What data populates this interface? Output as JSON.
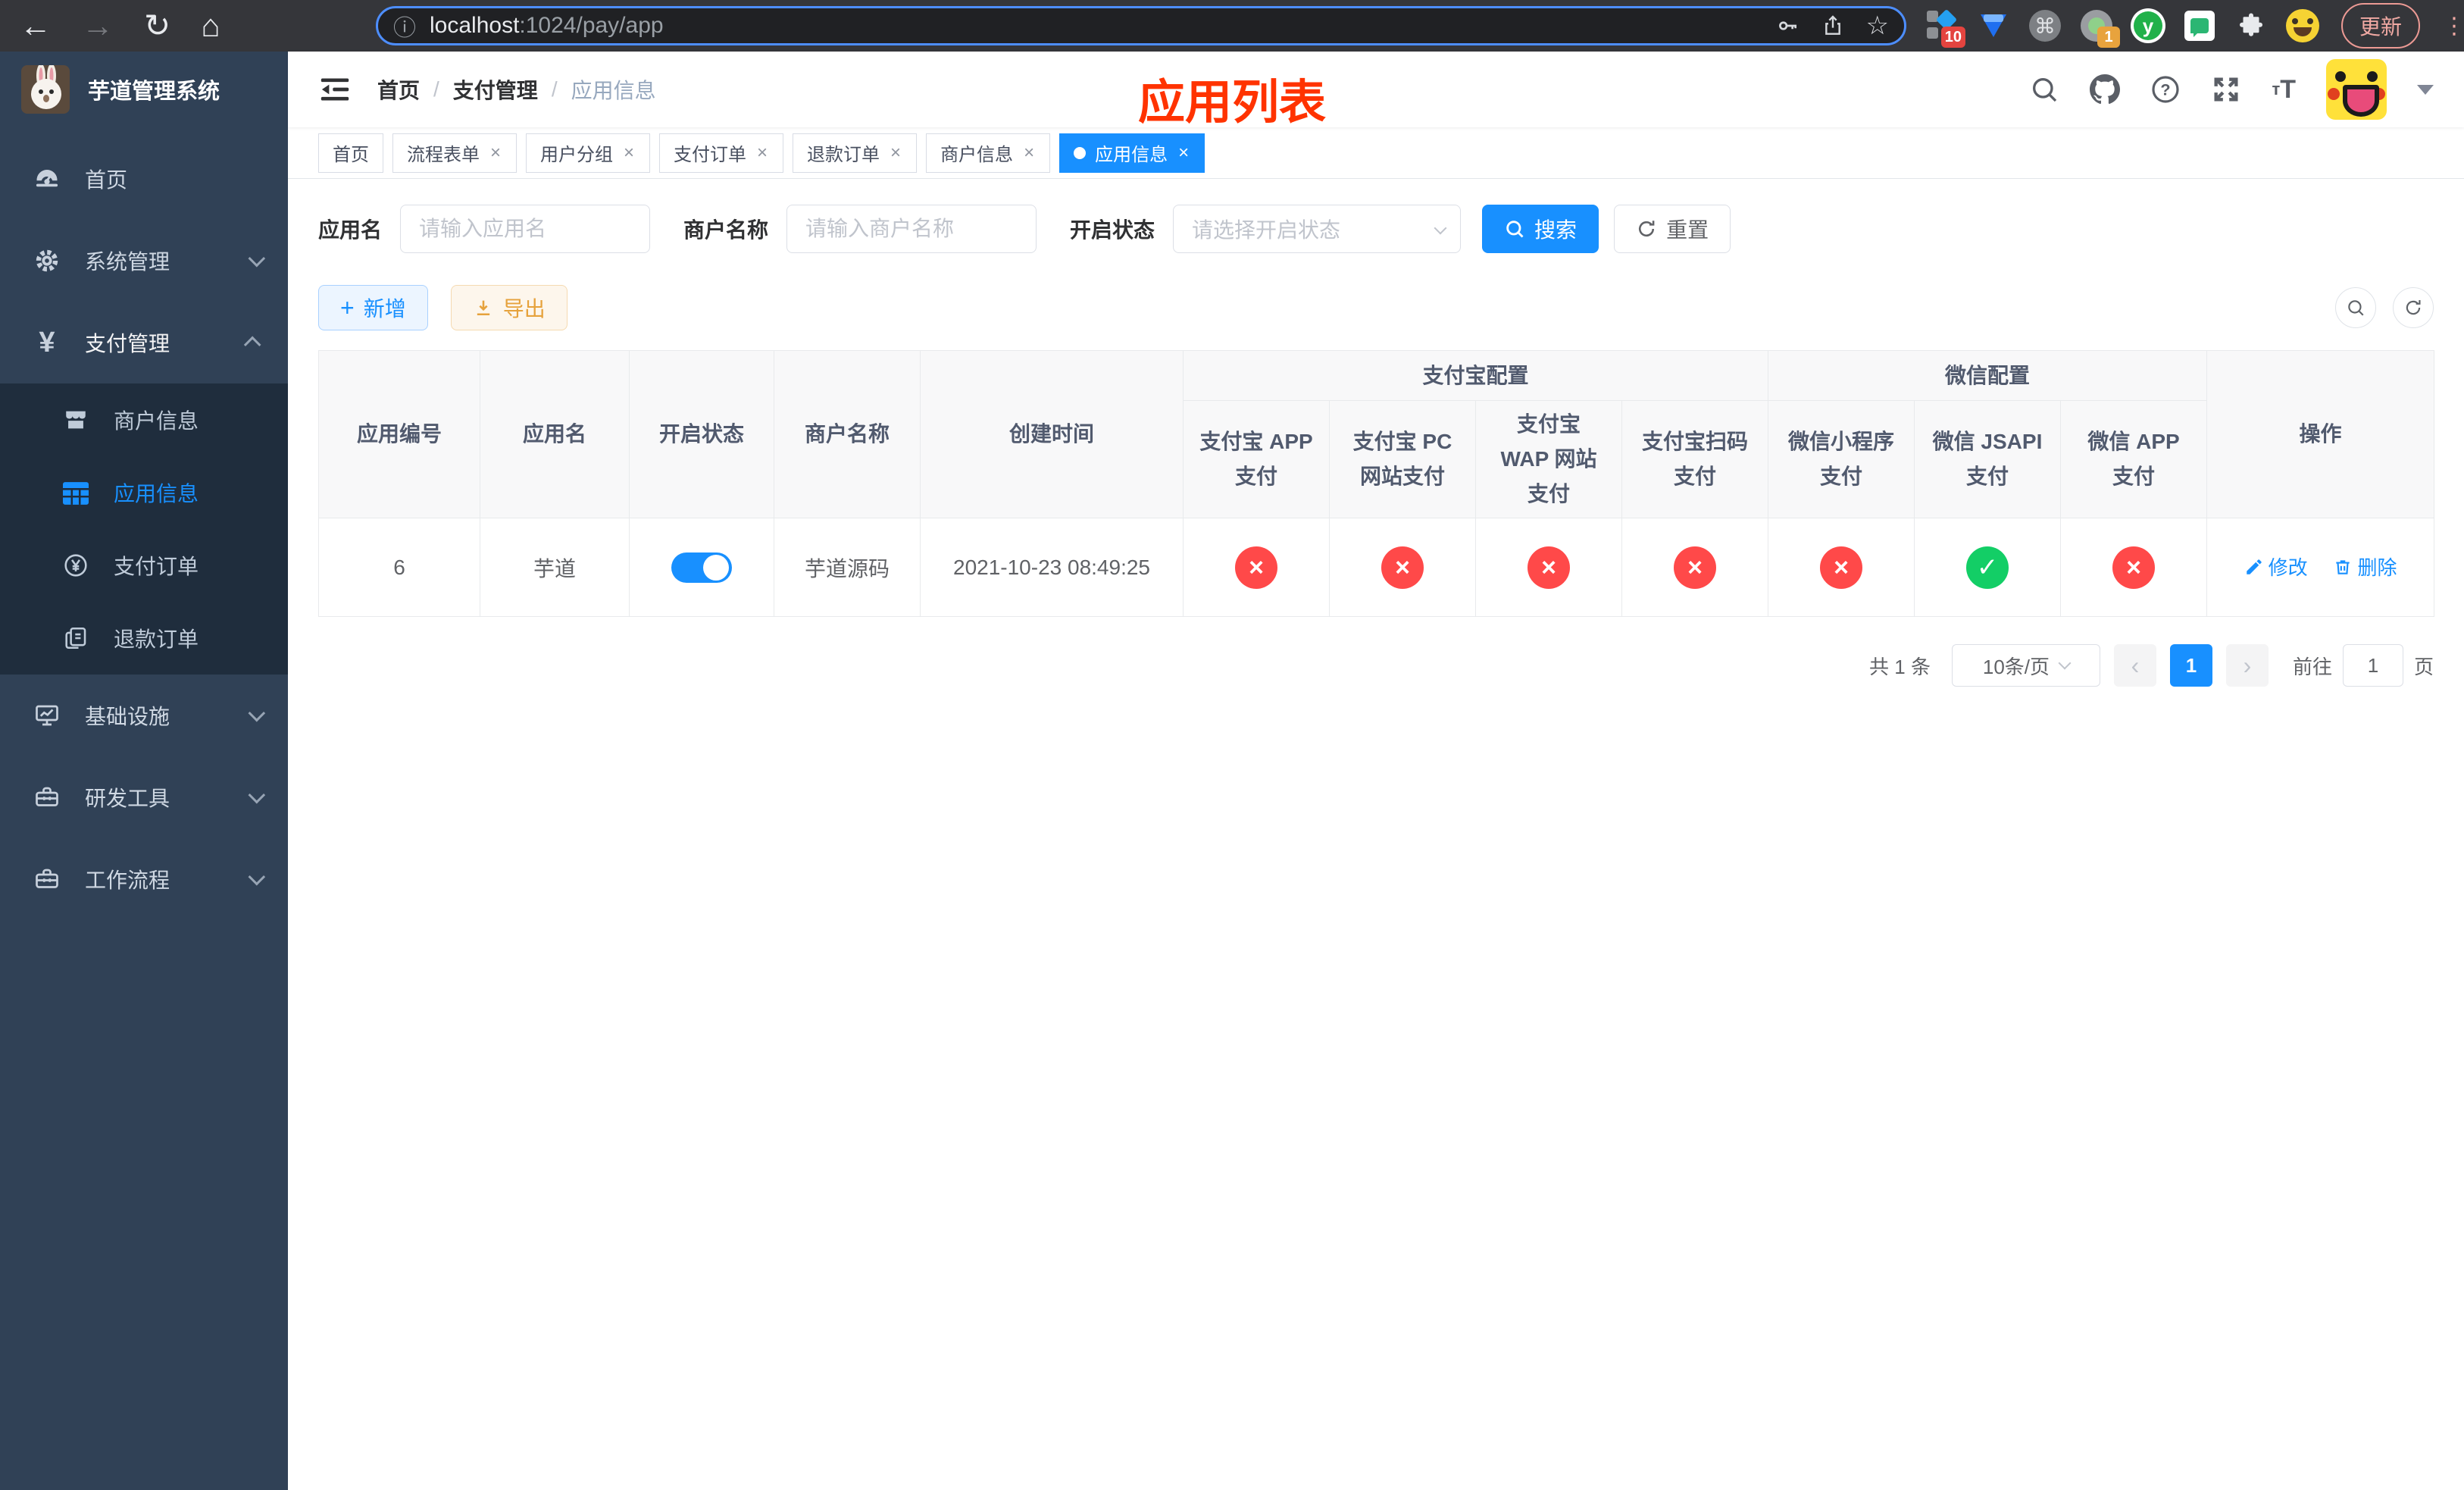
{
  "colors": {
    "accent": "#1890ff",
    "success": "#13ce66",
    "danger": "#ff4949",
    "warning": "#e6a23c",
    "annotation": "#ff3300",
    "sidebar": "#304156",
    "submenu": "#1f2d3d"
  },
  "icons": {
    "close": "×",
    "check": "✓",
    "cross": "×",
    "plus": "+",
    "prev": "‹",
    "next": "›",
    "dots": "⋮",
    "info": "ⓘ",
    "star": "☆",
    "command": "⌘",
    "back": "←",
    "forward": "→",
    "reload": "↻",
    "home": "⌂",
    "v_logo": "y"
  },
  "browser": {
    "url_host": "localhost",
    "url_path": ":1024/pay/app",
    "update_label": "更新",
    "ext_badge_10": "10",
    "ext_badge_1": "1"
  },
  "sidebar": {
    "logo_title": "芋道管理系统",
    "items": [
      {
        "label": "首页"
      },
      {
        "label": "系统管理"
      },
      {
        "label": "支付管理"
      },
      {
        "label": "商户信息"
      },
      {
        "label": "应用信息"
      },
      {
        "label": "支付订单"
      },
      {
        "label": "退款订单"
      },
      {
        "label": "基础设施"
      },
      {
        "label": "研发工具"
      },
      {
        "label": "工作流程"
      }
    ]
  },
  "header": {
    "breadcrumb": [
      "首页",
      "支付管理",
      "应用信息"
    ],
    "separator": "/",
    "annotation": "应用列表"
  },
  "tabs": [
    {
      "label": "首页"
    },
    {
      "label": "流程表单"
    },
    {
      "label": "用户分组"
    },
    {
      "label": "支付订单"
    },
    {
      "label": "退款订单"
    },
    {
      "label": "商户信息"
    },
    {
      "label": "应用信息"
    }
  ],
  "filters": {
    "app_name_label": "应用名",
    "app_name_placeholder": "请输入应用名",
    "merchant_label": "商户名称",
    "merchant_placeholder": "请输入商户名称",
    "status_label": "开启状态",
    "status_placeholder": "请选择开启状态",
    "search_label": "搜索",
    "reset_label": "重置"
  },
  "toolbar": {
    "add_label": "新增",
    "export_label": "导出"
  },
  "table": {
    "group_alipay": "支付宝配置",
    "group_wechat": "微信配置",
    "columns": [
      "应用编号",
      "应用名",
      "开启状态",
      "商户名称",
      "创建时间",
      "支付宝 APP 支付",
      "支付宝 PC 网站支付",
      "支付宝 WAP 网站支付",
      "支付宝扫码支付",
      "微信小程序支付",
      "微信 JSAPI 支付",
      "微信 APP 支付",
      "操作"
    ],
    "row": {
      "id": "6",
      "name": "芋道",
      "enabled": true,
      "merchant": "芋道源码",
      "created_at": "2021-10-23 08:49:25",
      "statuses": [
        false,
        false,
        false,
        false,
        false,
        true,
        false
      ],
      "edit_label": "修改",
      "delete_label": "删除"
    }
  },
  "pagination": {
    "total": "共 1 条",
    "page_size": "10条/页",
    "current": "1",
    "goto_label": "前往",
    "goto_value": "1",
    "unit": "页"
  }
}
